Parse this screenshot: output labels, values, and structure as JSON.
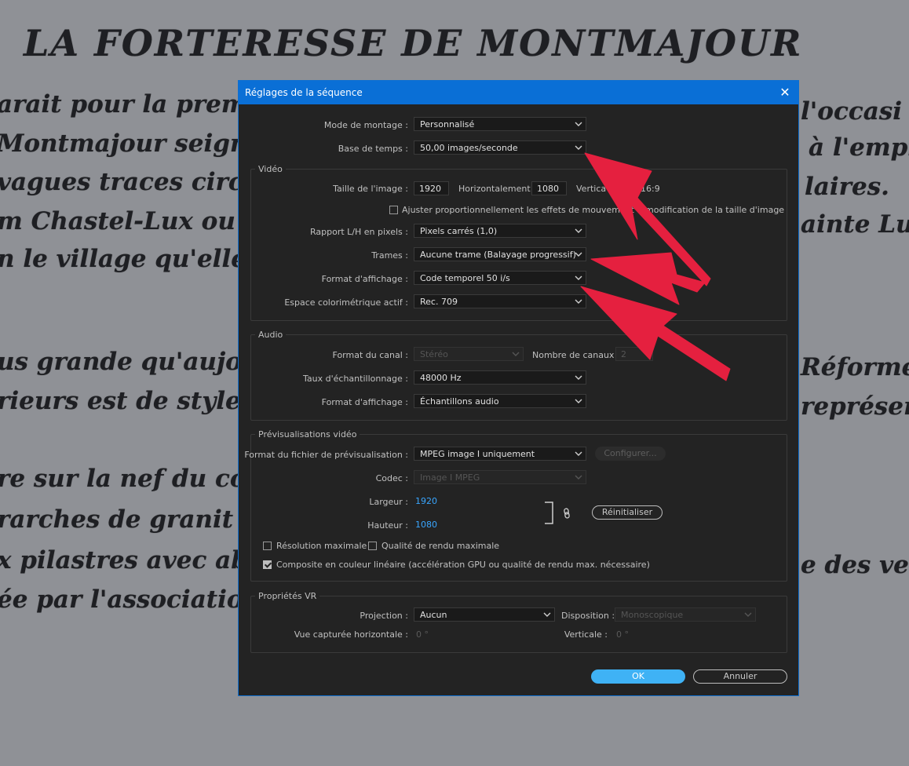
{
  "background": {
    "title": "LA FORTERESSE DE MONTMAJOUR",
    "left_lines": [
      "arait pour la premi",
      "Montmajour seigneu",
      "vagues traces circu",
      "m Chastel-Lux ou",
      "n le village qu'elle «",
      "us grande qu'aujour",
      "rieurs est de style ra",
      "re sur la nef du coté",
      "rarches de granit co",
      "x pilastres avec abs",
      "ée par l'association"
    ],
    "right_lines": [
      "l'occasi",
      "à l'empl",
      "laires.",
      "ainte Luc",
      "Réforme p",
      "représenta",
      "e des vei"
    ]
  },
  "dialog": {
    "title": "Réglages de la séquence",
    "close_glyph": "✕",
    "mode_montage": {
      "label": "Mode de montage :",
      "value": "Personnalisé"
    },
    "base_temps": {
      "label": "Base de temps :",
      "value": "50,00  images/seconde"
    },
    "video": {
      "section_title": "Vidéo",
      "taille_label": "Taille de l'image :",
      "width_value": "1920",
      "horiz_label": "Horizontalement",
      "height_value": "1080",
      "vert_label": "Vertica",
      "ratio": "16:9",
      "ajuster_label": "Ajuster proportionnellement les effets de mouvement lo",
      "ajuster_tail": "modification de la taille d'image",
      "rapport_label": "Rapport L/H en pixels :",
      "rapport_value": "Pixels carrés (1,0)",
      "trames_label": "Trames :",
      "trames_value": "Aucune trame (Balayage progressif)",
      "format_label": "Format d'affichage :",
      "format_value": "Code temporel 50 i/s",
      "espace_label": "Espace colorimétrique actif :",
      "espace_value": "Rec. 709"
    },
    "audio": {
      "section_title": "Audio",
      "canal_label": "Format du canal :",
      "canal_value": "Stéréo",
      "nombre_label": "Nombre de canaux :",
      "nombre_value": "2",
      "taux_label": "Taux d'échantillonnage :",
      "taux_value": "48000 Hz",
      "format_label": "Format d'affichage :",
      "format_value": "Échantillons audio"
    },
    "preview": {
      "section_title": "Prévisualisations vidéo",
      "fichier_label": "Format du fichier de prévisualisation :",
      "fichier_value": "MPEG image I uniquement",
      "configurer": "Configurer...",
      "codec_label": "Codec :",
      "codec_value": "Image I MPEG",
      "largeur_label": "Largeur :",
      "largeur_value": "1920",
      "hauteur_label": "Hauteur :",
      "hauteur_value": "1080",
      "reinit": "Réinitialiser",
      "res_max": "Résolution maximale",
      "qualite_max": "Qualité de rendu maximale",
      "composite": "Composite en couleur linéaire (accélération GPU ou qualité de rendu max. nécessaire)"
    },
    "vr": {
      "section_title": "Propriétés VR",
      "projection_label": "Projection :",
      "projection_value": "Aucun",
      "disposition_label": "Disposition :",
      "disposition_value": "Monoscopique",
      "vue_label": "Vue capturée horizontale :",
      "vue_value": "0 °",
      "verticale_label": "Verticale :",
      "verticale_value": "0 °"
    },
    "ok": "OK",
    "annuler": "Annuler"
  },
  "colors": {
    "accent_blue": "#0a6fd6",
    "ok_button": "#3fb2f5",
    "arrow_red": "#e5203f",
    "link_value": "#39a6ff"
  }
}
